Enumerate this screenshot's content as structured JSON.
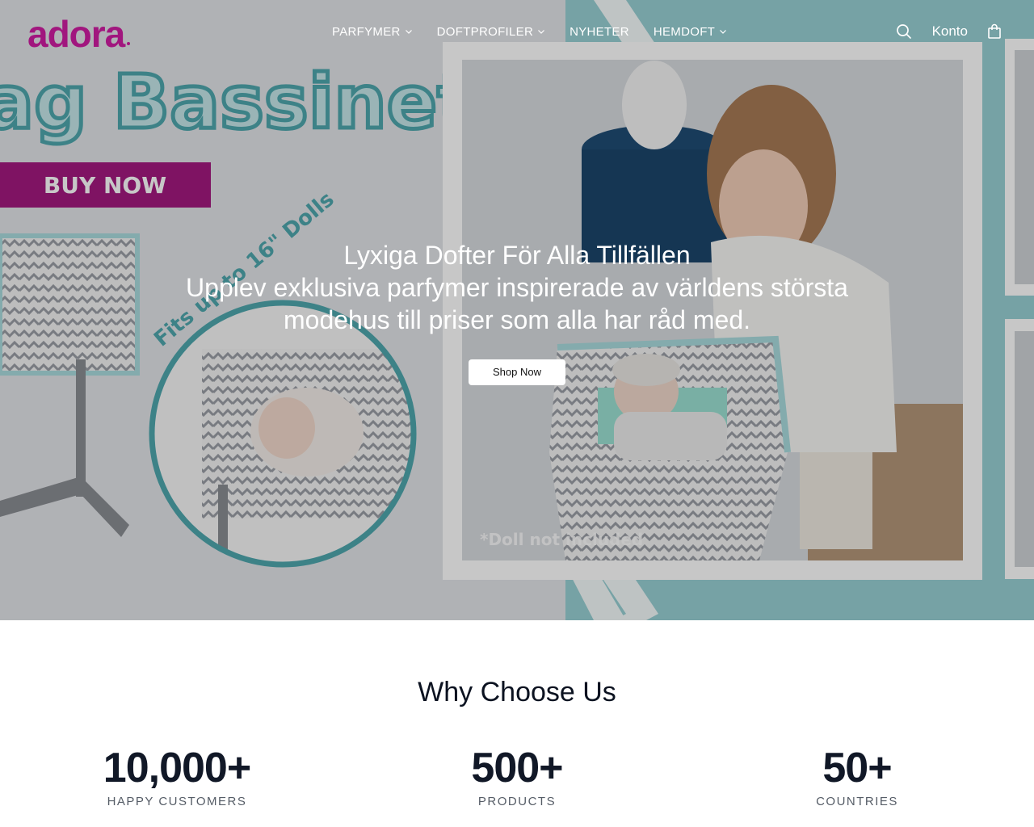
{
  "header": {
    "logo": "adora",
    "nav": [
      {
        "label": "PARFYMER",
        "has_dropdown": true
      },
      {
        "label": "DOFTPROFILER",
        "has_dropdown": true
      },
      {
        "label": "NYHETER",
        "has_dropdown": false
      },
      {
        "label": "HEMDOFT",
        "has_dropdown": true
      }
    ],
    "search_icon": "search-icon",
    "account_label": "Konto",
    "cart_icon": "shopping-bag-icon"
  },
  "hero": {
    "banner_text_heading": "ag Bassinet",
    "banner_button": "BUY NOW",
    "banner_circle_text": "Fits up to 16\" Dolls",
    "banner_note": "*Doll not included",
    "title": "Lyxiga Dofter För Alla Tillfällen",
    "subtitle": "Upplev exklusiva parfymer inspirerade av världens största modehus till priser som alla har råd med.",
    "cta": "Shop Now"
  },
  "why": {
    "title": "Why Choose Us",
    "stats": [
      {
        "value": "10,000+",
        "label": "HAPPY CUSTOMERS"
      },
      {
        "value": "500+",
        "label": "PRODUCTS"
      },
      {
        "value": "50+",
        "label": "COUNTRIES"
      }
    ]
  },
  "colors": {
    "brand": "#a1167e",
    "teal": "#8fc3c8",
    "text_dark": "#111827"
  }
}
